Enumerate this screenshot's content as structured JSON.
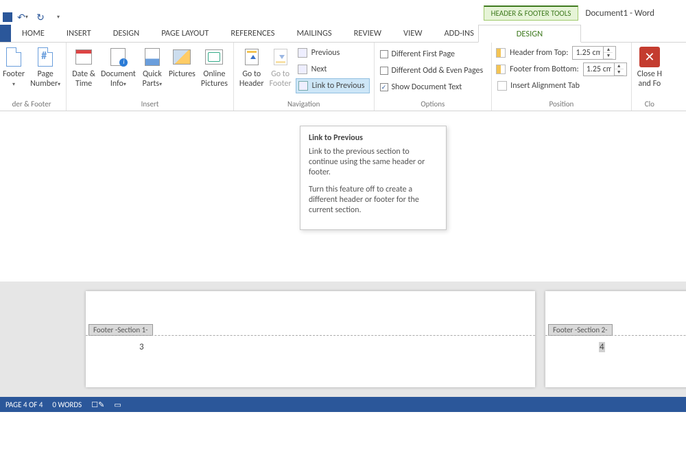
{
  "title_context": "HEADER & FOOTER TOOLS",
  "doc_title": "Document1 - Word",
  "tabs": {
    "home": "HOME",
    "insert": "INSERT",
    "design": "DESIGN",
    "pagelayout": "PAGE LAYOUT",
    "references": "REFERENCES",
    "mailings": "MAILINGS",
    "review": "REVIEW",
    "view": "VIEW",
    "addins": "ADD-INS",
    "ctx_design": "DESIGN"
  },
  "groups": {
    "hf": "der & Footer",
    "insert": "Insert",
    "navigation": "Navigation",
    "options": "Options",
    "position": "Position",
    "close": "Clo"
  },
  "hf": {
    "footer": "Footer",
    "pagenum": "Page\nNumber"
  },
  "insert": {
    "datetime": "Date &\nTime",
    "docinfo": "Document\nInfo",
    "quickparts": "Quick\nParts",
    "pictures": "Pictures",
    "onlinepics": "Online\nPictures"
  },
  "nav": {
    "gotoheader": "Go to\nHeader",
    "gotofooter": "Go to\nFooter",
    "previous": "Previous",
    "next": "Next",
    "linkprev": "Link to Previous"
  },
  "options": {
    "diff_first": "Different First Page",
    "diff_oddeven": "Different Odd & Even Pages",
    "showdoc": "Show Document Text"
  },
  "position": {
    "header_from_top": "Header from Top:",
    "footer_from_bottom": "Footer from Bottom:",
    "insert_align": "Insert Alignment Tab",
    "val_top": "1.25 cm",
    "val_bot": "1.25 cm"
  },
  "close": {
    "label": "Close H\nand Fo"
  },
  "tooltip": {
    "title": "Link to Previous",
    "p1": "Link to the previous section to continue using the same header or footer.",
    "p2": "Turn this feature off to create a different header or footer for the current section."
  },
  "doc": {
    "footer1": "Footer -Section 1-",
    "footer2": "Footer -Section 2-",
    "p3": "3",
    "p4": "4"
  },
  "status": {
    "page": "PAGE 4 OF 4",
    "words": "0 WORDS"
  }
}
